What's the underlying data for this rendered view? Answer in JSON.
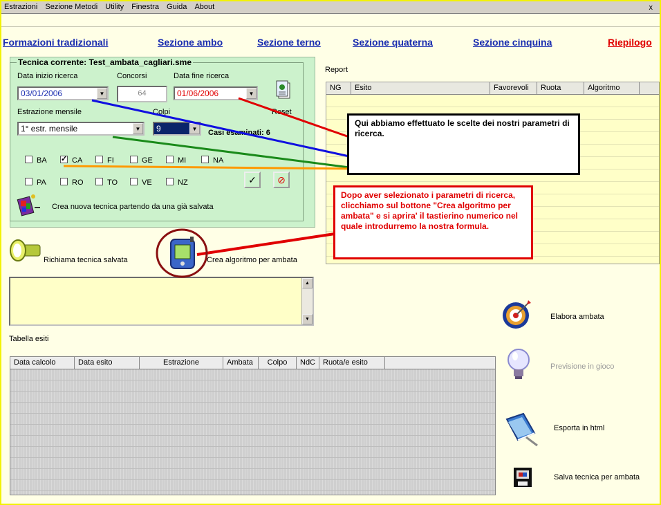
{
  "menu": {
    "items": [
      "Estrazioni",
      "Sezione Metodi",
      "Utility",
      "Finestra",
      "Guida",
      "About"
    ],
    "close_glyph": "x"
  },
  "nav": {
    "formazioni": "Formazioni tradizionali",
    "ambo": "Sezione ambo",
    "terno": "Sezione terno",
    "quaterna": "Sezione quaterna",
    "cinquina": "Sezione cinquina",
    "riepilogo": "Riepilogo"
  },
  "panel": {
    "legend": "Tecnica corrente: Test_ambata_cagliari.sme",
    "data_inizio_label": "Data inizio ricerca",
    "data_inizio_value": "03/01/2006",
    "concorsi_label": "Concorsi",
    "concorsi_value": "64",
    "data_fine_label": "Data fine ricerca",
    "data_fine_value": "01/06/2006",
    "reset_label": "Reset",
    "estrazione_label": "Estrazione mensile",
    "estrazione_value": "1° estr. mensile",
    "colpi_label": "Colpi",
    "colpi_value": "9",
    "casi_label": "Casi esaminati: 6",
    "wheels_row1": [
      "BA",
      "CA",
      "FI",
      "GE",
      "MI",
      "NA"
    ],
    "wheels_row2": [
      "PA",
      "RO",
      "TO",
      "VE",
      "NZ"
    ],
    "checked_wheel": "CA",
    "new_from_saved": "Crea nuova tecnica partendo da una già salvata"
  },
  "actions": {
    "richiama": "Richiama tecnica salvata",
    "crea_algoritmo": "Crea algoritmo per ambata",
    "elabora": "Elabora ambata",
    "previsione": "Previsione in gioco",
    "esporta": "Esporta in html",
    "salva": "Salva tecnica per ambata"
  },
  "report": {
    "label": "Report",
    "columns": [
      "NG",
      "Esito",
      "Favorevoli",
      "Ruota",
      "Algoritmo"
    ]
  },
  "tabella": {
    "label": "Tabella esiti",
    "columns": [
      "Data calcolo",
      "Data esito",
      "Estrazione",
      "Ambata",
      "Colpo",
      "NdC",
      "Ruota/e esito"
    ]
  },
  "notes": {
    "note1": "Qui abbiamo effettuato le scelte dei nostri parametri di ricerca.",
    "note2": "Dopo aver selezionato i parametri di ricerca, clicchiamo sul bottone \"Crea algoritmo per ambata\" e si aprira' il tastierino numerico nel quale introdurremo la nostra formula."
  },
  "colors": {
    "panel_bg": "#ccf2cc",
    "nav_link": "#1a2db0",
    "riepilogo": "#e00000",
    "annotation_red": "#e00000",
    "line_blue": "#1010e0",
    "line_green": "#1a8a1a",
    "line_orange": "#ff9900"
  },
  "icons": [
    "reset-icon",
    "paint-icon",
    "flashlight-icon",
    "pda-icon",
    "target-icon",
    "lightbulb-icon",
    "book-icon",
    "film-save-icon",
    "check-icon",
    "cancel-icon"
  ]
}
